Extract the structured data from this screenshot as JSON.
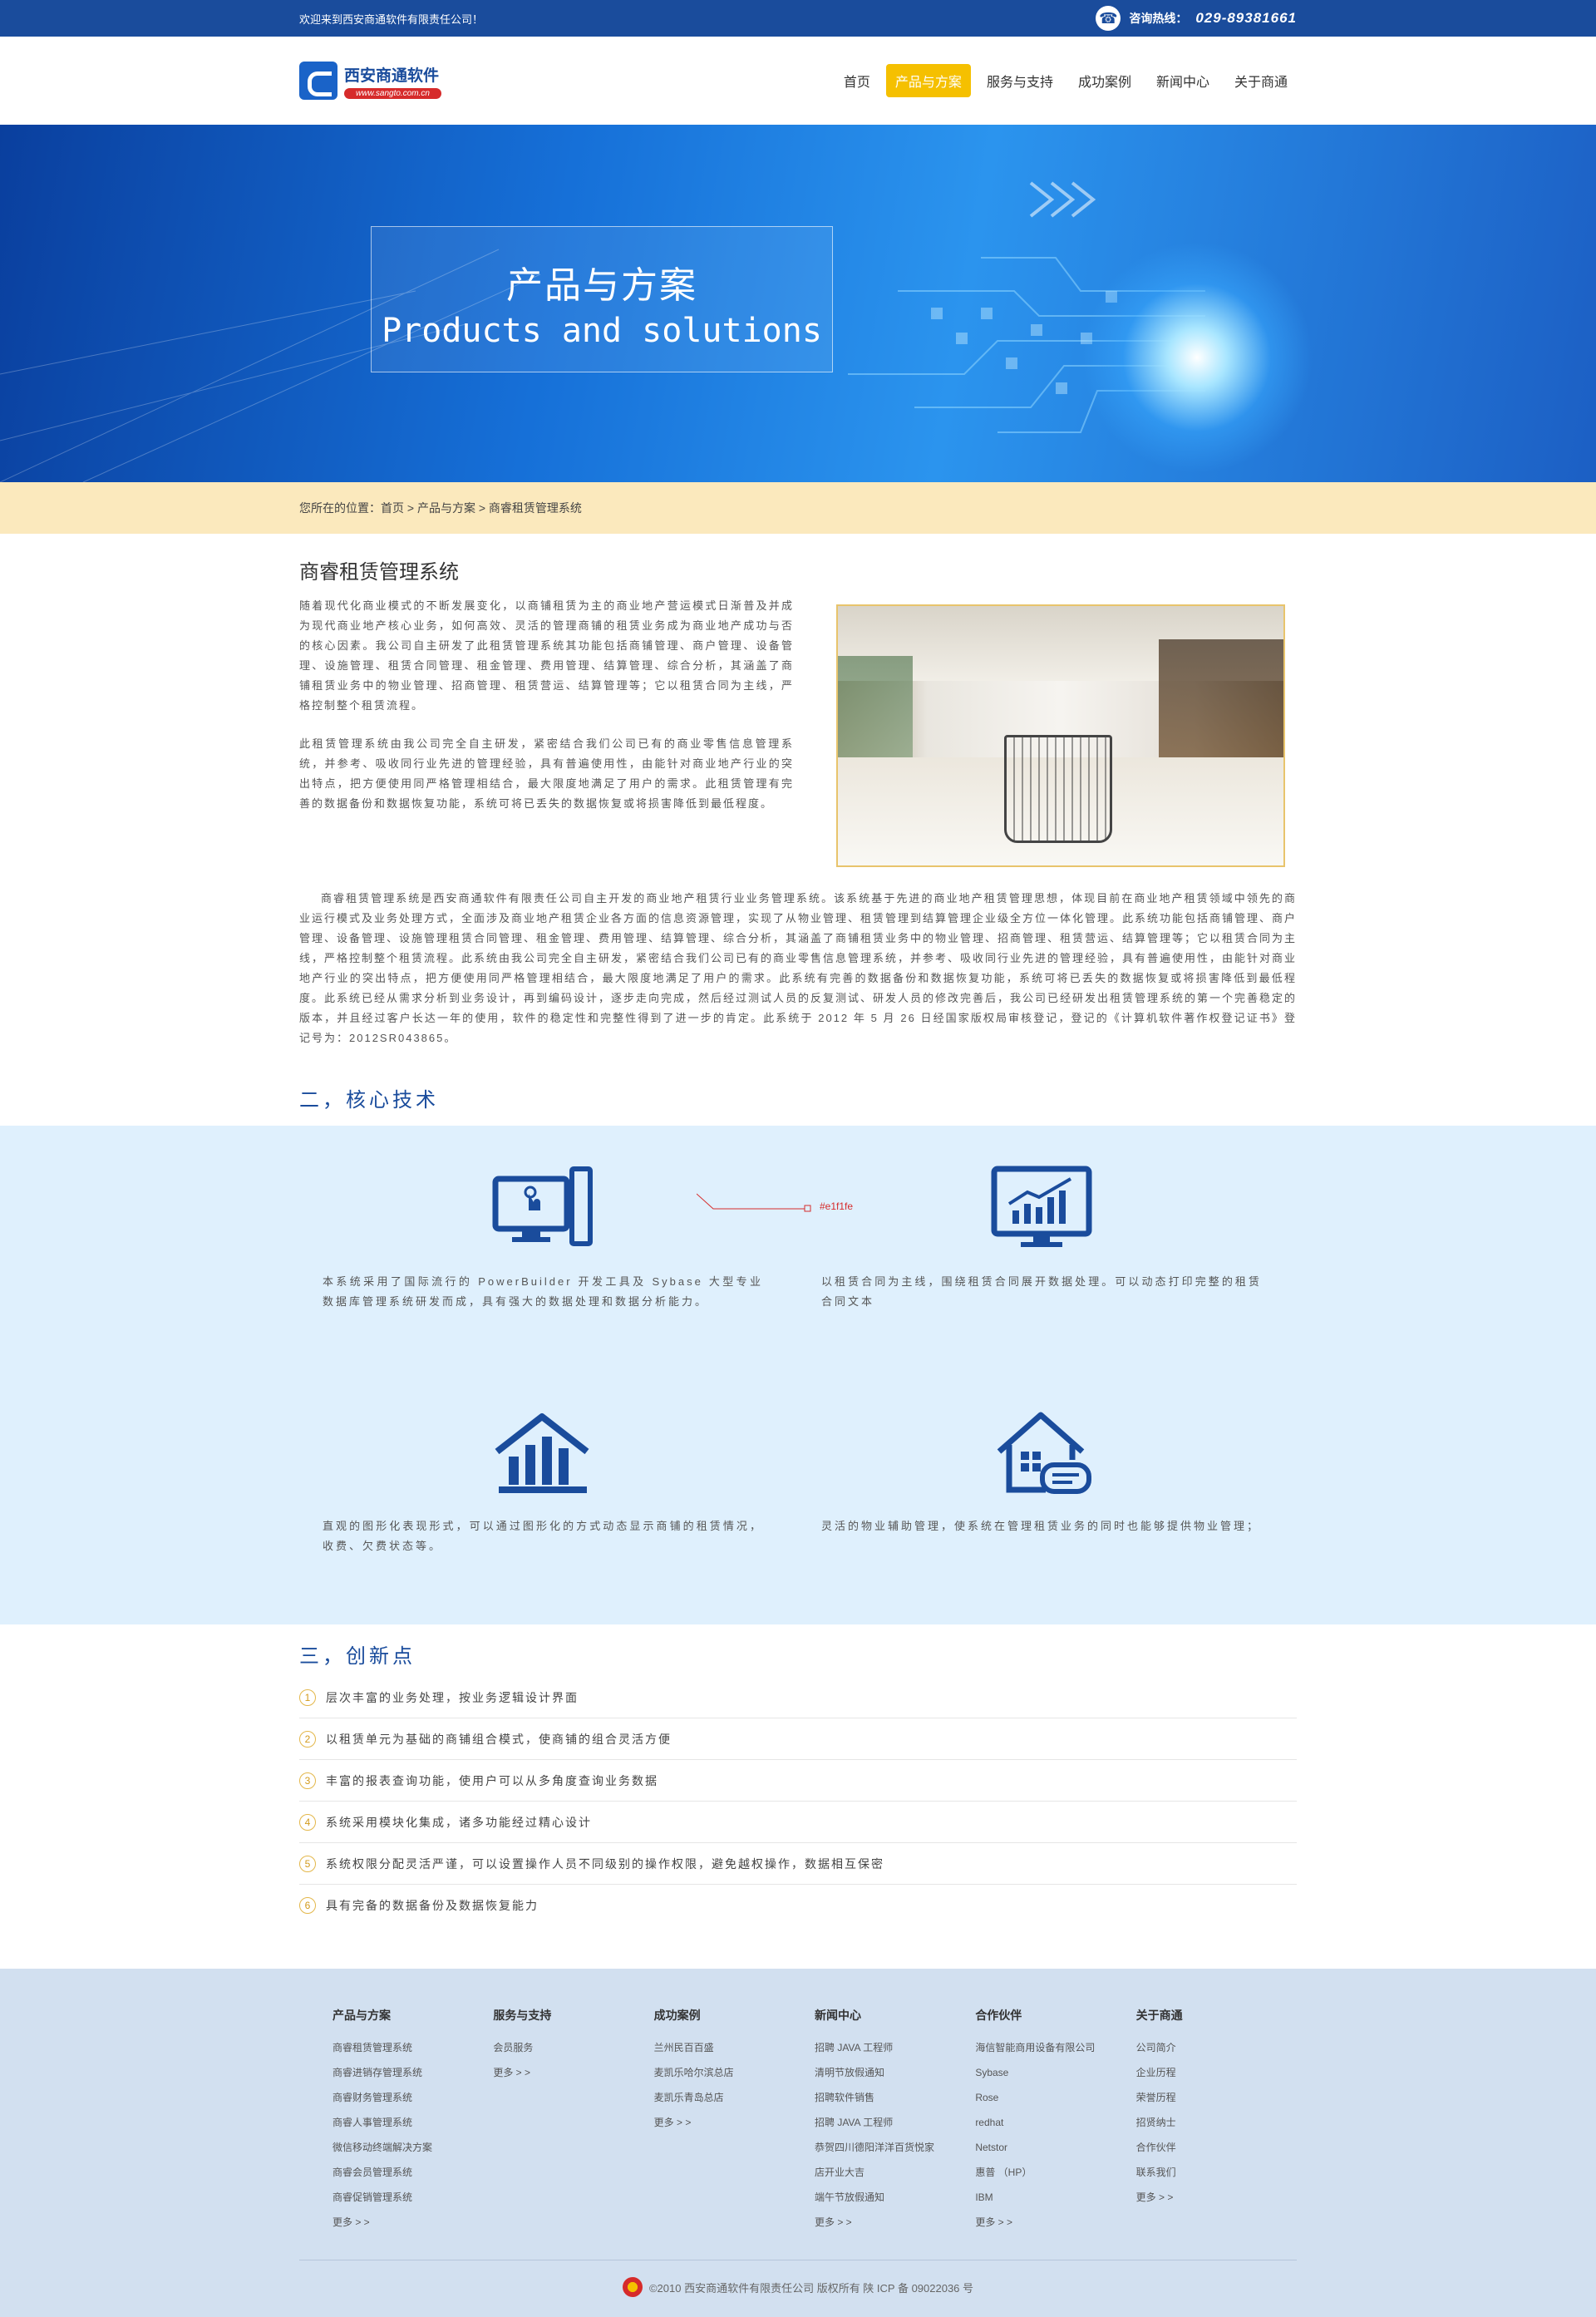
{
  "topbar": {
    "welcome": "欢迎来到西安商通软件有限责任公司！",
    "hotline_label": "咨询热线：",
    "hotline_number": "029-89381661",
    "phone_icon": "phone-icon"
  },
  "logo": {
    "name": "西安商通软件",
    "url": "www.sangto.com.cn"
  },
  "nav": [
    {
      "label": "首页"
    },
    {
      "label": "产品与方案",
      "active": true
    },
    {
      "label": "服务与支持"
    },
    {
      "label": "成功案例"
    },
    {
      "label": "新闻中心"
    },
    {
      "label": "关于商通"
    }
  ],
  "banner": {
    "title_cn": "产品与方案",
    "title_en": "Products and solutions"
  },
  "breadcrumb": {
    "text": "您所在的位置：首页 > 产品与方案 > 商睿租赁管理系统"
  },
  "intro": {
    "title": "商睿租赁管理系统",
    "para1": "随着现代化商业模式的不断发展变化，以商铺租赁为主的商业地产营运模式日渐普及并成为现代商业地产核心业务，如何高效、灵活的管理商铺的租赁业务成为商业地产成功与否的核心因素。我公司自主研发了此租赁管理系统其功能包括商铺管理、商户管理、设备管理、设施管理、租赁合同管理、租金管理、费用管理、结算管理、综合分析，其涵盖了商铺租赁业务中的物业管理、招商管理、租赁营运、结算管理等；它以租赁合同为主线，严格控制整个租赁流程。",
    "para2": " 此租赁管理系统由我公司完全自主研发，紧密结合我们公司已有的商业零售信息管理系统，并参考、吸收同行业先进的管理经验，具有普遍使用性，由能针对商业地产行业的突出特点，把方便使用同严格管理相结合，最大限度地满足了用户的需求。此租赁管理有完善的数据备份和数据恢复功能，系统可将已丢失的数据恢复或将损害降低到最低程度。",
    "para3": "商睿租赁管理系统是西安商通软件有限责任公司自主开发的商业地产租赁行业业务管理系统。该系统基于先进的商业地产租赁管理思想，体现目前在商业地产租赁领域中领先的商业运行模式及业务处理方式，全面涉及商业地产租赁企业各方面的信息资源管理，实现了从物业管理、租赁管理到结算管理企业级全方位一体化管理。此系统功能包括商铺管理、商户管理、设备管理、设施管理租赁合同管理、租金管理、费用管理、结算管理、综合分析，其涵盖了商铺租赁业务中的物业管理、招商管理、租赁营运、结算管理等；它以租赁合同为主线，严格控制整个租赁流程。此系统由我公司完全自主研发，紧密结合我们公司已有的商业零售信息管理系统，并参考、吸收同行业先进的管理经验，具有普遍使用性，由能针对商业地产行业的突出特点，把方便使用同严格管理相结合，最大限度地满足了用户的需求。此系统有完善的数据备份和数据恢复功能，系统可将已丢失的数据恢复或将损害降低到最低程度。此系统已经从需求分析到业务设计，再到编码设计，逐步走向完成，然后经过测试人员的反复测试、研发人员的修改完善后，我公司已经研发出租赁管理系统的第一个完善稳定的版本，并且经过客户长达一年的使用，软件的稳定性和完整性得到了进一步的肯定。此系统于 2012 年 5 月 26 日经国家版权局审核登记，登记的《计算机软件著作权登记证书》登记号为：2012SR043865。"
  },
  "tech": {
    "title": "二，核心技术",
    "annotation": "#e1f1fe",
    "items": [
      {
        "icon": "computer-touch-icon",
        "text": "本系统采用了国际流行的 PowerBuilder 开发工具及 Sybase 大型专业数据库管理系统研发而成，具有强大的数据处理和数据分析能力。"
      },
      {
        "icon": "chart-monitor-icon",
        "text": "以租赁合同为主线，围绕租赁合同展开数据处理。可以动态打印完整的租赁合同文本"
      },
      {
        "icon": "bar-chart-house-icon",
        "text": "直观的图形化表现形式，可以通过图形化的方式动态显示商铺的租赁情况，收费、欠费状态等。"
      },
      {
        "icon": "house-message-icon",
        "text": "灵活的物业辅助管理，使系统在管理租赁业务的同时也能够提供物业管理；"
      }
    ]
  },
  "innovation": {
    "title": "三，创新点",
    "items": [
      {
        "num": "1",
        "text": "层次丰富的业务处理，按业务逻辑设计界面"
      },
      {
        "num": "2",
        "text": "以租赁单元为基础的商铺组合模式，使商铺的组合灵活方便"
      },
      {
        "num": "3",
        "text": "丰富的报表查询功能，使用户可以从多角度查询业务数据"
      },
      {
        "num": "4",
        "text": "系统采用模块化集成，诸多功能经过精心设计"
      },
      {
        "num": "5",
        "text": "系统权限分配灵活严谨，可以设置操作人员不同级别的操作权限，避免越权操作，数据相互保密"
      },
      {
        "num": "6",
        "text": "具有完备的数据备份及数据恢复能力"
      }
    ]
  },
  "footer": {
    "columns": [
      {
        "title": "产品与方案",
        "links": [
          "商睿租赁管理系统",
          "商睿进销存管理系统",
          "商睿财务管理系统",
          "商睿人事管理系统",
          "微信移动终端解决方案",
          "商睿会员管理系统",
          "商睿促销管理系统",
          "更多 > >"
        ]
      },
      {
        "title": "服务与支持",
        "links": [
          "会员服务",
          "更多 > >"
        ]
      },
      {
        "title": "成功案例",
        "links": [
          "兰州民百百盛",
          "麦凯乐哈尔滨总店",
          "麦凯乐青岛总店",
          "更多 > >"
        ]
      },
      {
        "title": "新闻中心",
        "links": [
          "招聘 JAVA 工程师",
          "清明节放假通知",
          "招聘软件销售",
          "招聘 JAVA 工程师",
          "恭贺四川德阳洋洋百货悦家",
          "店开业大吉",
          "端午节放假通知",
          "更多 > >"
        ]
      },
      {
        "title": "合作伙伴",
        "links": [
          "海信智能商用设备有限公司",
          "Sybase",
          "Rose",
          "redhat",
          "Netstor",
          "惠普 （HP）",
          "IBM",
          "更多 > >"
        ]
      },
      {
        "title": "关于商通",
        "links": [
          "公司简介",
          "企业历程",
          "荣誉历程",
          "招贤纳士",
          "合作伙伴",
          "联系我们",
          "更多 > >"
        ]
      }
    ],
    "copyright": "©2010 西安商通软件有限责任公司 版权所有    陕 ICP 备 09022036 号"
  }
}
